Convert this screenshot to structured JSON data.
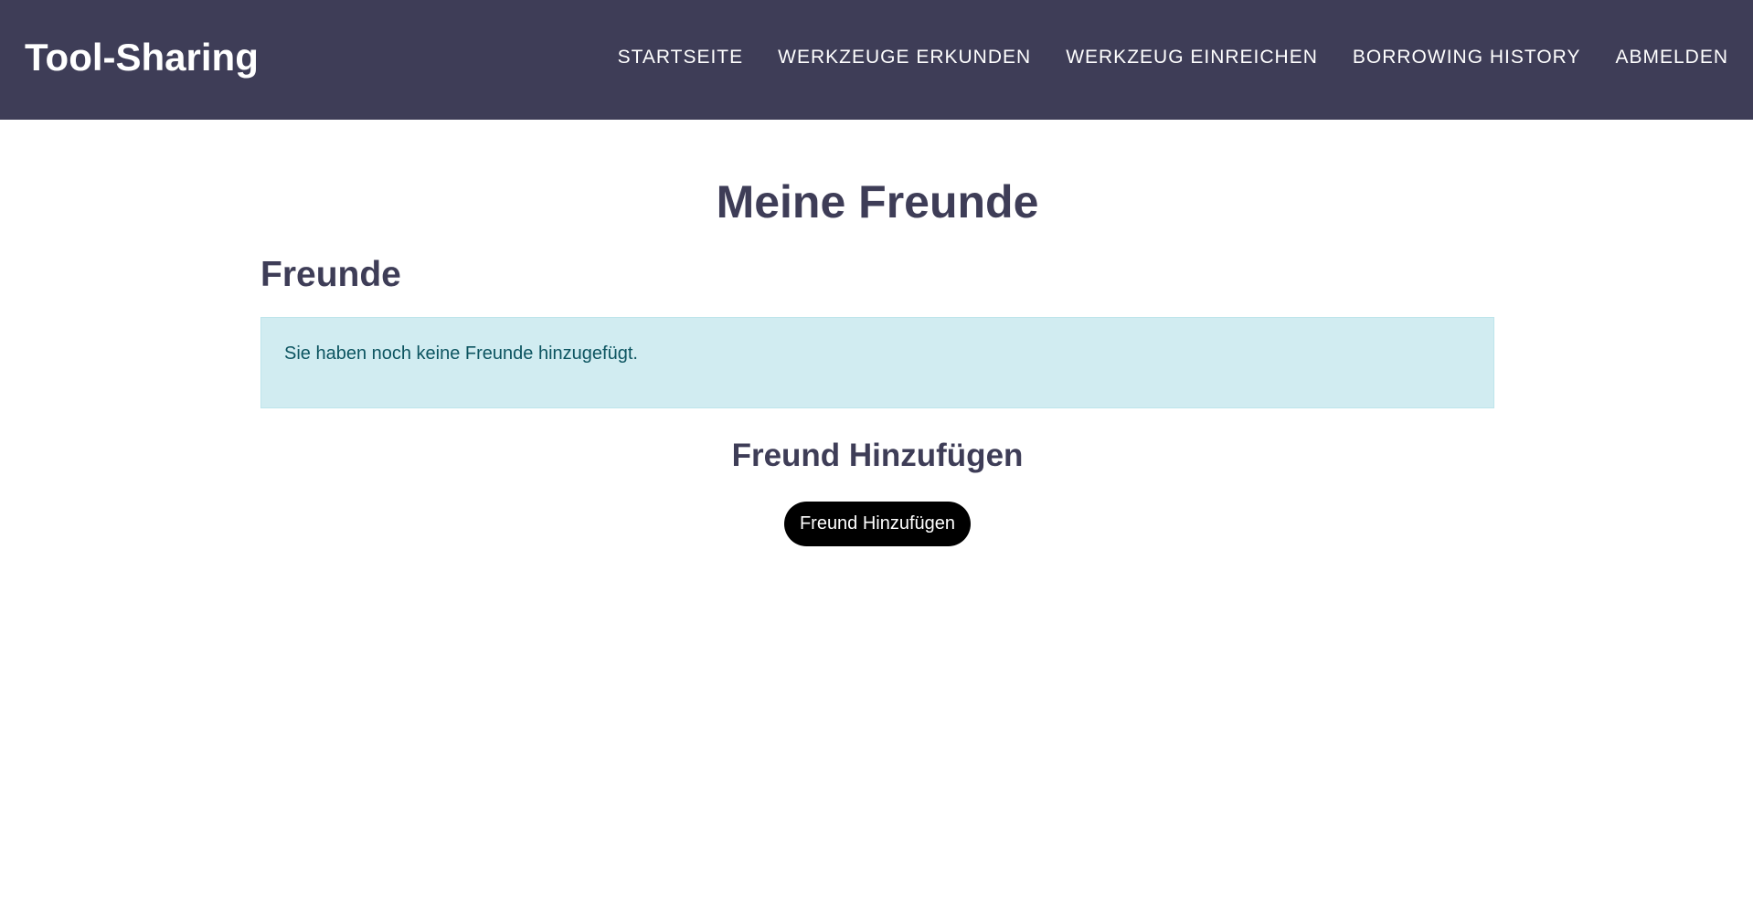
{
  "navbar": {
    "brand": "Tool-Sharing",
    "links": [
      {
        "label": "Startseite"
      },
      {
        "label": "Werkzeuge erkunden"
      },
      {
        "label": "Werkzeug einreichen"
      },
      {
        "label": "Borrowing History"
      },
      {
        "label": "Abmelden"
      }
    ]
  },
  "main": {
    "title": "Meine Freunde",
    "friends_heading": "Freunde",
    "empty_message": "Sie haben noch keine Freunde hinzugefügt.",
    "add_heading": "Freund Hinzufügen",
    "add_button": "Freund Hinzufügen"
  },
  "colors": {
    "navbar_bg": "#3e3d57",
    "heading": "#3e3d57",
    "alert_bg": "#d1ecf1",
    "alert_text": "#0c5460",
    "button_bg": "#000000"
  }
}
